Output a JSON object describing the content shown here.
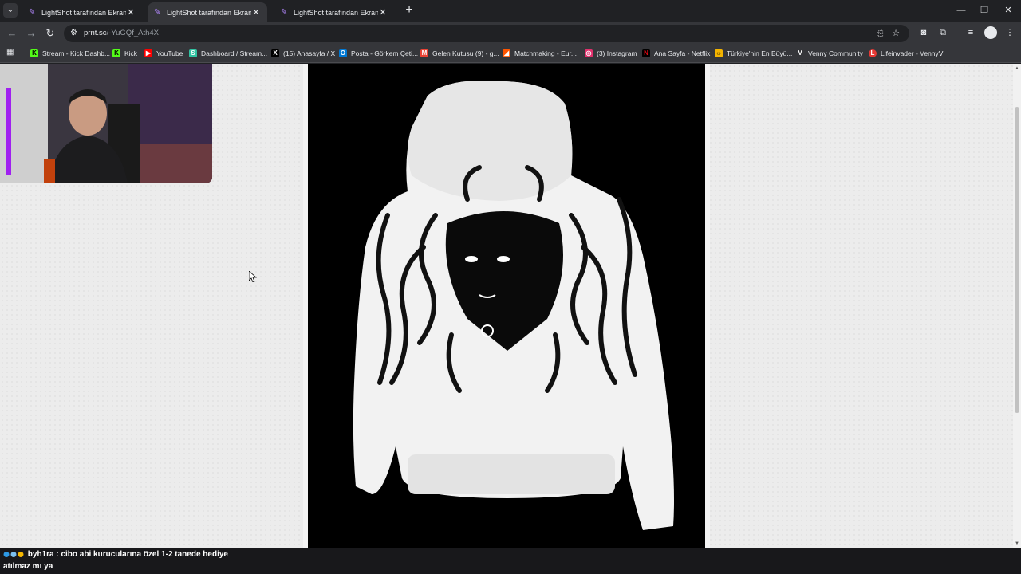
{
  "tabs": [
    {
      "title": "LightShot tarafından Ekran Görüntüsü"
    },
    {
      "title": "LightShot tarafından Ekran Görüntüsü"
    },
    {
      "title": "LightShot tarafından Ekran Görüntüsü"
    }
  ],
  "address": {
    "host": "prnt.sc",
    "path": "/-YuGQf_Ath4X"
  },
  "bookmarks": [
    {
      "label": "Stream - Kick Dashb...",
      "icon": "kick-icon",
      "color": "#53fc18"
    },
    {
      "label": "Kick",
      "icon": "kick-icon",
      "color": "#53fc18"
    },
    {
      "label": "YouTube",
      "icon": "youtube-icon",
      "color": "#ff0000"
    },
    {
      "label": "Dashboard / Stream...",
      "icon": "streamlabs-icon",
      "color": "#31c3a2"
    },
    {
      "label": "(15) Anasayfa / X",
      "icon": "x-icon",
      "color": "#000000"
    },
    {
      "label": "Posta - Görkem Çeti...",
      "icon": "outlook-icon",
      "color": "#0078d4"
    },
    {
      "label": "Gelen Kutusu (9) - g...",
      "icon": "gmail-icon",
      "color": "#ea4335"
    },
    {
      "label": "Matchmaking - Eur...",
      "icon": "faceit-icon",
      "color": "#ff5500"
    },
    {
      "label": "(3) Instagram",
      "icon": "instagram-icon",
      "color": "#e1306c"
    },
    {
      "label": "Ana Sayfa - Netflix",
      "icon": "netflix-icon",
      "color": "#e50914"
    },
    {
      "label": "Türkiye'nin En Büyü...",
      "icon": "site-icon",
      "color": "#f4b400"
    },
    {
      "label": "Venny Community",
      "icon": "venny-icon",
      "color": "#ffffff"
    },
    {
      "label": "Lifeinvader - VennyV",
      "icon": "lifeinvader-icon",
      "color": "#e53935"
    }
  ],
  "chat": {
    "username": "byh1ra",
    "message_line1": "cibo abi kurucularına özel 1-2 tanede hediye",
    "message_line2": "atılmaz mı ya"
  }
}
